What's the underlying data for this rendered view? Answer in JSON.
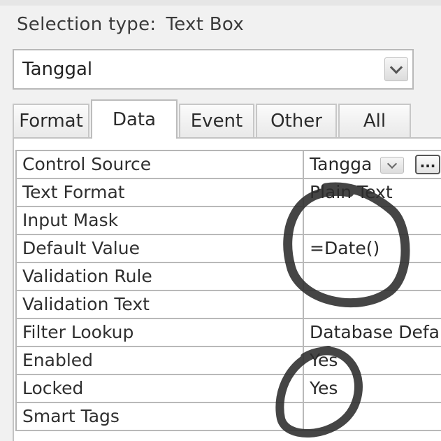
{
  "selection": {
    "label": "Selection type:",
    "type": "Text Box"
  },
  "object_combo": {
    "value": "Tanggal",
    "icon": "chevron-down-icon"
  },
  "tabs": [
    {
      "label": "Format",
      "active": false
    },
    {
      "label": "Data",
      "active": true
    },
    {
      "label": "Event",
      "active": false
    },
    {
      "label": "Other",
      "active": false
    },
    {
      "label": "All",
      "active": false
    }
  ],
  "properties": [
    {
      "name": "Control Source",
      "value": "Tangga"
    },
    {
      "name": "Text Format",
      "value": "Plain Text"
    },
    {
      "name": "Input Mask",
      "value": ""
    },
    {
      "name": "Default Value",
      "value": "=Date()"
    },
    {
      "name": "Validation Rule",
      "value": ""
    },
    {
      "name": "Validation Text",
      "value": ""
    },
    {
      "name": "Filter Lookup",
      "value": "Database Defa"
    },
    {
      "name": "Enabled",
      "value": "Yes"
    },
    {
      "name": "Locked",
      "value": "Yes"
    },
    {
      "name": "Smart Tags",
      "value": ""
    }
  ],
  "build_button": {
    "label": "..."
  },
  "colors": {
    "annotation_ink": "#2b2b2b",
    "grid_border": "#b9b9b9",
    "panel_bg": "#f1f1f1"
  }
}
